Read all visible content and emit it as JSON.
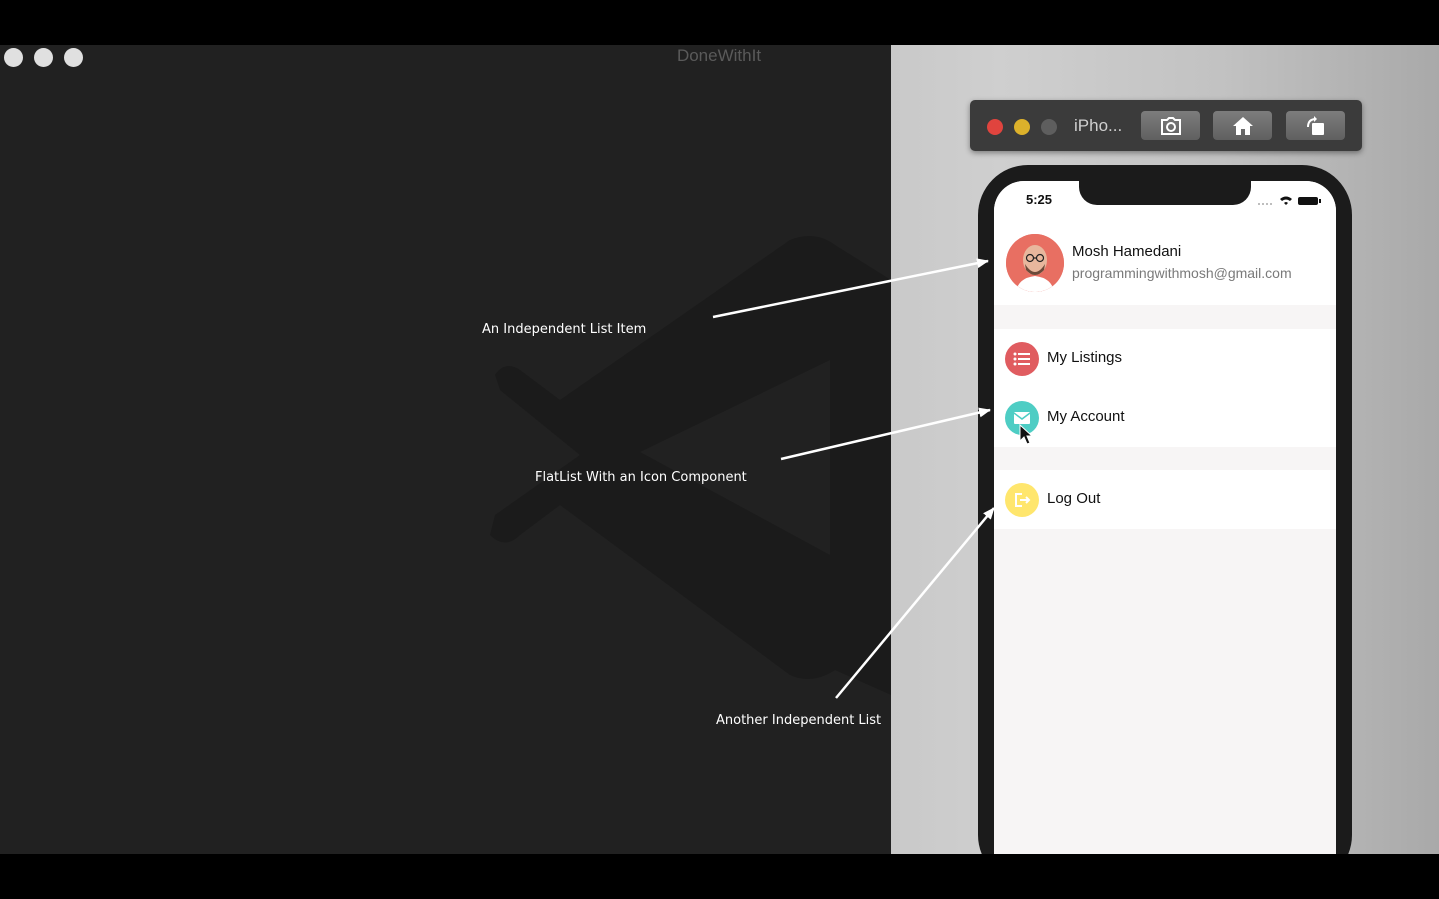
{
  "window": {
    "title": "DoneWithIt"
  },
  "annotations": [
    "An Independent List Item",
    "FlatList With an Icon Component",
    "Another Independent List"
  ],
  "simulator": {
    "name": "iPho...",
    "buttons": [
      "screenshot-icon",
      "home-icon",
      "rotate-icon"
    ]
  },
  "phone": {
    "time": "5:25",
    "profile": {
      "name": "Mosh Hamedani",
      "email": "programmingwithmosh@gmail.com"
    },
    "menu": [
      {
        "label": "My Listings",
        "icon": "list-icon",
        "color": "#e05c60"
      },
      {
        "label": "My Account",
        "icon": "email-icon",
        "color": "#4ecdc4"
      }
    ],
    "logout": {
      "label": "Log Out",
      "icon": "logout-icon",
      "color": "#ffe66d"
    }
  }
}
